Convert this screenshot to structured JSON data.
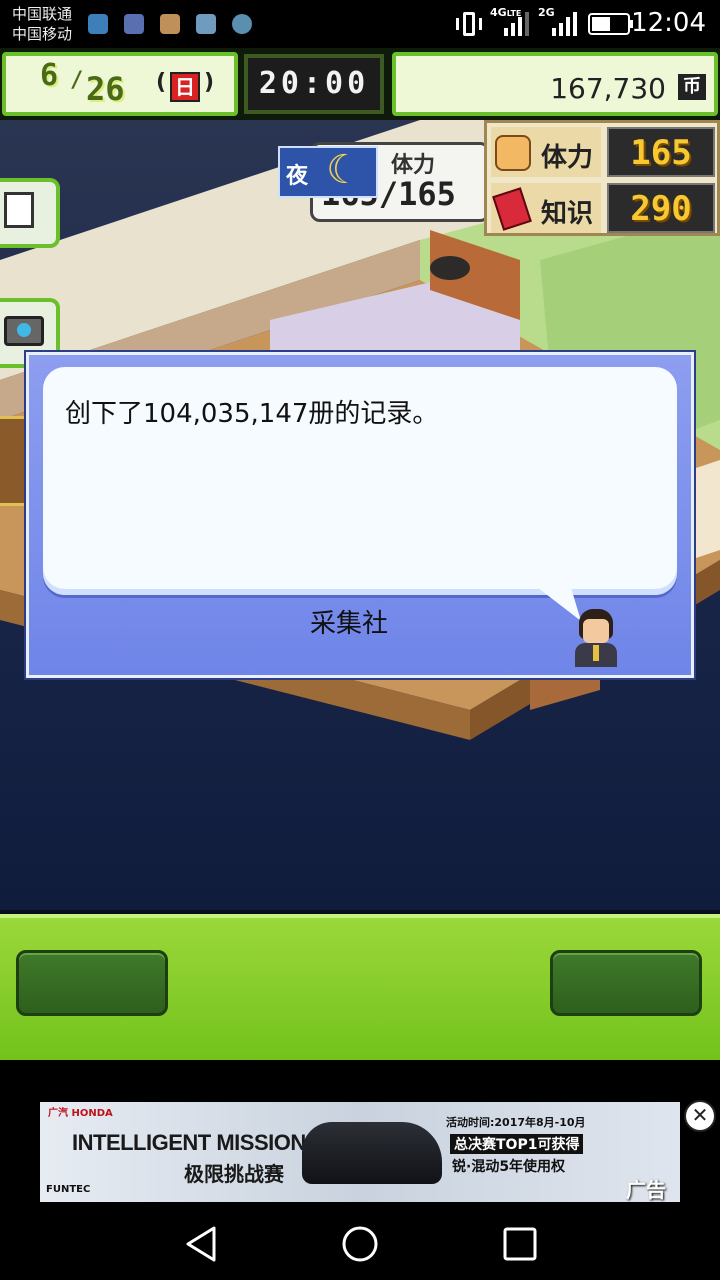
{
  "status_bar": {
    "carrier_1": "中国联通",
    "carrier_2": "中国移动",
    "network_1": "4G",
    "network_1_sub": "LTE",
    "network_2": "2G",
    "time": "12:04"
  },
  "hud": {
    "month": "6",
    "day": "26",
    "weekday": "日",
    "clock": "20:00",
    "money": "167,730",
    "currency": "币",
    "weather_label": "夜",
    "stamina_label": "体力",
    "stamina_current": "165",
    "stamina_max": "165",
    "knowledge_label": "知识",
    "knowledge_value": "290"
  },
  "dialog": {
    "message": "创下了104,035,147册的记录。",
    "speaker": "采集社"
  },
  "ad": {
    "brand_left": "广汽 HONDA",
    "headline": "INTELLIGENT MISSION",
    "headline_sub": "极限挑战赛",
    "footer_brand": "FUNTEC",
    "event_time": "活动时间:2017年8月-10月",
    "promo_line_1": "总决赛TOP1可获得",
    "promo_line_2": "锐·混动5年使用权",
    "ad_label": "广告"
  },
  "colors": {
    "hud_green": "#6bbf2a",
    "dialog_blue": "#7a8fec",
    "control_green": "#73c21c"
  }
}
